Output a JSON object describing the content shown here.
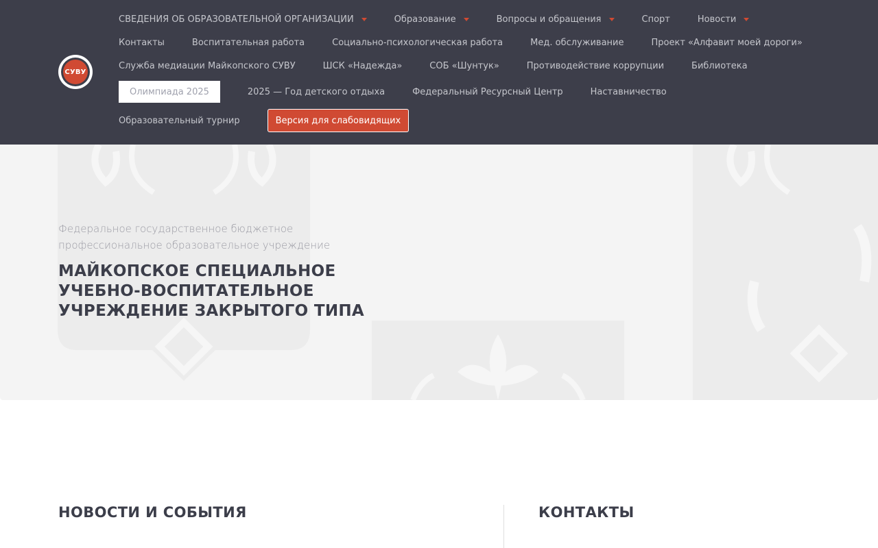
{
  "logo": {
    "text": "СУВУ"
  },
  "nav": {
    "row1": [
      {
        "label": "СВЕДЕНИЯ ОБ ОБРАЗОВАТЕЛЬНОЙ ОРГАНИЗАЦИИ",
        "dropdown": true
      },
      {
        "label": "Образование",
        "dropdown": true
      },
      {
        "label": "Вопросы и обращения",
        "dropdown": true
      },
      {
        "label": "Спорт",
        "dropdown": false
      },
      {
        "label": "Новости",
        "dropdown": true
      }
    ],
    "row2": [
      {
        "label": "Контакты"
      },
      {
        "label": "Воспитательная работа"
      },
      {
        "label": "Социально-психологическая работа"
      },
      {
        "label": "Мед. обслуживание"
      },
      {
        "label": "Проект «Алфавит моей дороги»"
      }
    ],
    "row3": [
      {
        "label": "Служба медиации Майкопского СУВУ"
      },
      {
        "label": "ШСК «Надежда»"
      },
      {
        "label": "СОБ «Шунтук»"
      },
      {
        "label": "Противодействие коррупции"
      },
      {
        "label": "Библиотека"
      }
    ],
    "row4": [
      {
        "label": "Олимпиада 2025",
        "active": true
      },
      {
        "label": "2025 — Год детского отдыха"
      },
      {
        "label": "Федеральный Ресурсный Центр"
      },
      {
        "label": "Наставничество"
      }
    ],
    "row5": [
      {
        "label": "Образовательный турнир"
      }
    ],
    "accessibility_button": "Версия для слабовидящих"
  },
  "hero": {
    "subtitle_line1": "Федеральное государственное бюджетное",
    "subtitle_line2": "профессиональное образовательное учреждение",
    "title_line1": "МАЙКОПСКОЕ СПЕЦИАЛЬНОЕ",
    "title_line2": "УЧЕБНО-ВОСПИТАТЕЛЬНОЕ",
    "title_line3": "УЧРЕЖДЕНИЕ ЗАКРЫТОГО ТИПА"
  },
  "sections": {
    "news_title": "НОВОСТИ И СОБЫТИЯ",
    "contacts_title": "КОНТАКТЫ"
  },
  "colors": {
    "header_bg": "#3d3e4a",
    "accent": "#d04a33",
    "hero_bg": "#f4f4f4"
  }
}
